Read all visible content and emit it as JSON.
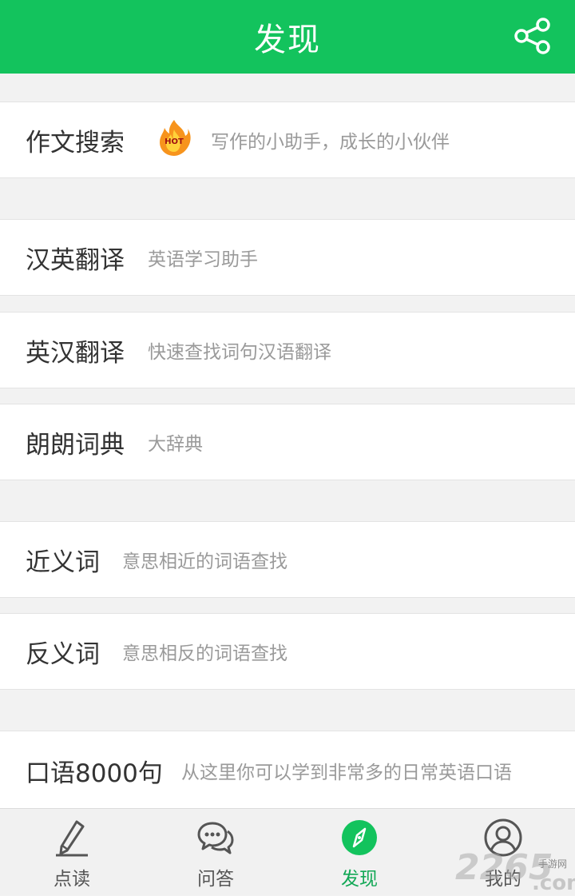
{
  "header": {
    "title": "发现",
    "share_icon": "share-icon",
    "color": "#13c35d"
  },
  "items": [
    {
      "title": "作文搜索",
      "desc": "写作的小助手，成长的小伙伴",
      "badge": "HOT"
    },
    {
      "title": "汉英翻译",
      "desc": "英语学习助手"
    },
    {
      "title": "英汉翻译",
      "desc": "快速查找词句汉语翻译"
    },
    {
      "title": "朗朗词典",
      "desc": "大辞典"
    },
    {
      "title": "近义词",
      "desc": "意思相近的词语查找"
    },
    {
      "title": "反义词",
      "desc": "意思相反的词语查找"
    },
    {
      "title": "口语8000句",
      "desc": "从这里你可以学到非常多的日常英语口语"
    }
  ],
  "tabs": [
    {
      "label": "点读",
      "icon": "pen-icon"
    },
    {
      "label": "问答",
      "icon": "chat-bubble-icon"
    },
    {
      "label": "发现",
      "icon": "compass-icon",
      "active": true
    },
    {
      "label": "我的",
      "icon": "user-icon"
    }
  ],
  "watermark": {
    "number": "2265",
    "site": "手游网",
    "domain": ".com"
  },
  "colors": {
    "accent": "#13c35d",
    "active_tab": "#13a856",
    "text": "#333333",
    "muted": "#9a9a9a"
  }
}
